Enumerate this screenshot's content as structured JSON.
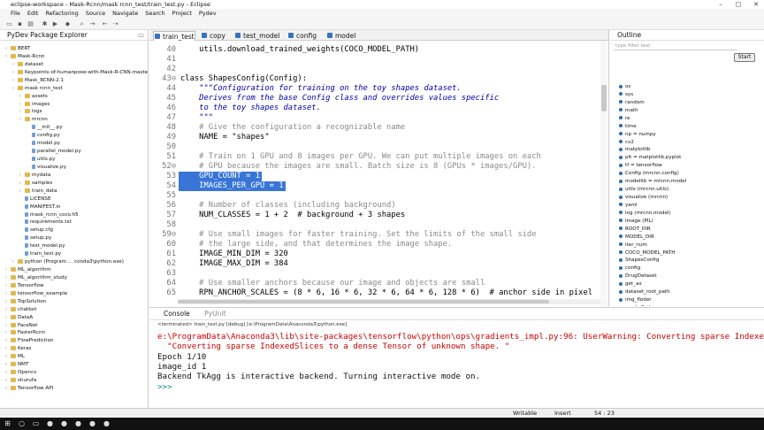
{
  "window": {
    "title": "eclipse-workspace - Mask-Rcnn/mask rcnn_test/train_test.py - Eclipse"
  },
  "menu": [
    "File",
    "Edit",
    "Refactoring",
    "Source",
    "Navigate",
    "Search",
    "Project",
    "Pydev"
  ],
  "explorer": {
    "title": "PyDev Package Explorer",
    "items": [
      {
        "label": "BERT",
        "indent": 0,
        "type": "folder"
      },
      {
        "label": "Mask-Rcnn",
        "indent": 0,
        "type": "folder"
      },
      {
        "label": "dataset",
        "indent": 1,
        "type": "folder"
      },
      {
        "label": "Keypoints-of-humanpose-with-Mask-R-CNN-master",
        "indent": 1,
        "type": "folder"
      },
      {
        "label": "Mask_RCNN-2.1",
        "indent": 1,
        "type": "folder"
      },
      {
        "label": "mask rcnn_test",
        "indent": 1,
        "type": "folder"
      },
      {
        "label": "assets",
        "indent": 2,
        "type": "folder"
      },
      {
        "label": "images",
        "indent": 2,
        "type": "folder"
      },
      {
        "label": "logs",
        "indent": 2,
        "type": "folder"
      },
      {
        "label": "mrcnn",
        "indent": 2,
        "type": "folder"
      },
      {
        "label": "__init__.py",
        "indent": 3,
        "type": "file"
      },
      {
        "label": "config.py",
        "indent": 3,
        "type": "file"
      },
      {
        "label": "model.py",
        "indent": 3,
        "type": "file"
      },
      {
        "label": "parallel_model.py",
        "indent": 3,
        "type": "file"
      },
      {
        "label": "utils.py",
        "indent": 3,
        "type": "file"
      },
      {
        "label": "visualize.py",
        "indent": 3,
        "type": "file"
      },
      {
        "label": "mydata",
        "indent": 2,
        "type": "folder"
      },
      {
        "label": "samples",
        "indent": 2,
        "type": "folder"
      },
      {
        "label": "train_data",
        "indent": 2,
        "type": "folder"
      },
      {
        "label": "LICENSE",
        "indent": 2,
        "type": "file"
      },
      {
        "label": "MANIFEST.in",
        "indent": 2,
        "type": "file"
      },
      {
        "label": "mask_rcnn_coco.h5",
        "indent": 2,
        "type": "file"
      },
      {
        "label": "requirements.txt",
        "indent": 2,
        "type": "file"
      },
      {
        "label": "setup.cfg",
        "indent": 2,
        "type": "file"
      },
      {
        "label": "setup.py",
        "indent": 2,
        "type": "file"
      },
      {
        "label": "test_model.py",
        "indent": 2,
        "type": "file"
      },
      {
        "label": "train_test.py",
        "indent": 2,
        "type": "file"
      },
      {
        "label": "python (Program ... conda3\\python.exe)",
        "indent": 1,
        "type": "folder"
      },
      {
        "label": "ML_algorithm",
        "indent": 0,
        "type": "folder"
      },
      {
        "label": "ML_algorithm_study",
        "indent": 0,
        "type": "folder"
      },
      {
        "label": "Tensorflow",
        "indent": 0,
        "type": "folder"
      },
      {
        "label": "tensorflow_example",
        "indent": 0,
        "type": "folder"
      },
      {
        "label": "TopSolution",
        "indent": 0,
        "type": "folder"
      },
      {
        "label": "chatbot",
        "indent": 0,
        "type": "folder"
      },
      {
        "label": "DataA",
        "indent": 0,
        "type": "folder"
      },
      {
        "label": "FaceNet",
        "indent": 0,
        "type": "folder"
      },
      {
        "label": "FasterRcnn",
        "indent": 0,
        "type": "folder"
      },
      {
        "label": "FlowPrediction",
        "indent": 0,
        "type": "folder"
      },
      {
        "label": "Keras",
        "indent": 0,
        "type": "folder"
      },
      {
        "label": "ML",
        "indent": 0,
        "type": "folder"
      },
      {
        "label": "NMT",
        "indent": 0,
        "type": "folder"
      },
      {
        "label": "Opencv",
        "indent": 0,
        "type": "folder"
      },
      {
        "label": "shurufa",
        "indent": 0,
        "type": "folder"
      },
      {
        "label": "Tensorflow API",
        "indent": 0,
        "type": "folder"
      }
    ]
  },
  "editor": {
    "tabs": [
      "train_test",
      "copy",
      "test_model",
      "config",
      "model"
    ],
    "active_tab": 0,
    "lines": [
      {
        "n": "40",
        "text": "    utils.download_trained_weights(COCO_MODEL_PATH)",
        "cls": ""
      },
      {
        "n": "41",
        "text": "",
        "cls": ""
      },
      {
        "n": "42",
        "text": "",
        "cls": ""
      },
      {
        "n": "43⊖",
        "text": "class ShapesConfig(Config):",
        "cls": "kwline"
      },
      {
        "n": "44",
        "text": "    \"\"\"Configuration for training on the toy shapes dataset.",
        "cls": "doc"
      },
      {
        "n": "45",
        "text": "    Derives from the base Config class and overrides values specific",
        "cls": "doc"
      },
      {
        "n": "46",
        "text": "    to the toy shapes dataset.",
        "cls": "doc"
      },
      {
        "n": "47",
        "text": "    \"\"\"",
        "cls": "doc"
      },
      {
        "n": "48",
        "text": "    # Give the configuration a recognizable name",
        "cls": "cmt"
      },
      {
        "n": "49",
        "text": "    NAME = \"shapes\"",
        "cls": "name"
      },
      {
        "n": "50",
        "text": "",
        "cls": ""
      },
      {
        "n": "51",
        "text": "    # Train on 1 GPU and 8 images per GPU. We can put multiple images on each",
        "cls": "cmt"
      },
      {
        "n": "52⊖",
        "text": "    # GPU because the images are small. Batch size is 8 (GPUs * images/GPU).",
        "cls": "cmt"
      },
      {
        "n": "53",
        "text": "    GPU_COUNT = 1",
        "cls": "sel"
      },
      {
        "n": "54",
        "text": "    IMAGES_PER_GPU = 1",
        "cls": "sel"
      },
      {
        "n": "55",
        "text": "",
        "cls": ""
      },
      {
        "n": "56",
        "text": "    # Number of classes (including background)",
        "cls": "cmt"
      },
      {
        "n": "57",
        "text": "    NUM_CLASSES = 1 + 2  # background + 3 shapes",
        "cls": "mixed"
      },
      {
        "n": "58",
        "text": "",
        "cls": ""
      },
      {
        "n": "59⊖",
        "text": "    # Use small images for faster training. Set the limits of the small side",
        "cls": "cmt"
      },
      {
        "n": "60",
        "text": "    # the large side, and that determines the image shape.",
        "cls": "cmt"
      },
      {
        "n": "61",
        "text": "    IMAGE_MIN_DIM = 320",
        "cls": ""
      },
      {
        "n": "62",
        "text": "    IMAGE_MAX_DIM = 384",
        "cls": ""
      },
      {
        "n": "63",
        "text": "",
        "cls": ""
      },
      {
        "n": "64",
        "text": "    # Use smaller anchors because our image and objects are small",
        "cls": "cmt"
      },
      {
        "n": "65",
        "text": "    RPN_ANCHOR_SCALES = (8 * 6, 16 * 6, 32 * 6, 64 * 6, 128 * 6)  # anchor side in pixel",
        "cls": "mixed2"
      }
    ]
  },
  "outline": {
    "title": "Outline",
    "filter_placeholder": "type filter text",
    "start_label": "Start",
    "items": [
      "os",
      "sys",
      "random",
      "math",
      "re",
      "time",
      "np = numpy",
      "cv2",
      "matplotlib",
      "plt = matplotlib.pyplot",
      "tf = tensorflow",
      "Config (mrcnn.config)",
      "modellib = mrcnn.model",
      "utils (mrcnn.utils)",
      "visualize (mrcnn)",
      "yaml",
      "log (mrcnn.model)",
      "Image (PIL)",
      "ROOT_DIR",
      "MODEL_DIR",
      "iter_num",
      "COCO_MODEL_PATH",
      "ShapesConfig",
      "config",
      "DrugDataset",
      "get_ax",
      "dataset_root_path",
      "img_floder",
      "mask_floder",
      "imglist",
      "count",
      "dataset_train",
      "dataset_val"
    ]
  },
  "console": {
    "tabs": [
      "Console",
      "PyUnit"
    ],
    "terminated": "<terminated> train_test.py [debug] [e:\\ProgramData\\Anaconda3\\python.exe]",
    "lines": [
      {
        "text": "e:\\ProgramData\\Anaconda3\\lib\\site-packages\\tensorflow\\python\\ops\\gradients_impl.py:96: UserWarning: Converting sparse Indexed",
        "cls": "err"
      },
      {
        "text": "  \"Converting sparse IndexedSlices to a dense Tensor of unknown shape. \"",
        "cls": "err"
      },
      {
        "text": "Epoch 1/10",
        "cls": ""
      },
      {
        "text": "image_id 1",
        "cls": ""
      },
      {
        "text": "Backend TkAgg is interactive backend. Turning interactive mode on.",
        "cls": ""
      },
      {
        "text": ">>>",
        "cls": "prompt"
      }
    ]
  },
  "status": {
    "writable": "Writable",
    "insert": "Insert",
    "position": "54 : 23"
  }
}
